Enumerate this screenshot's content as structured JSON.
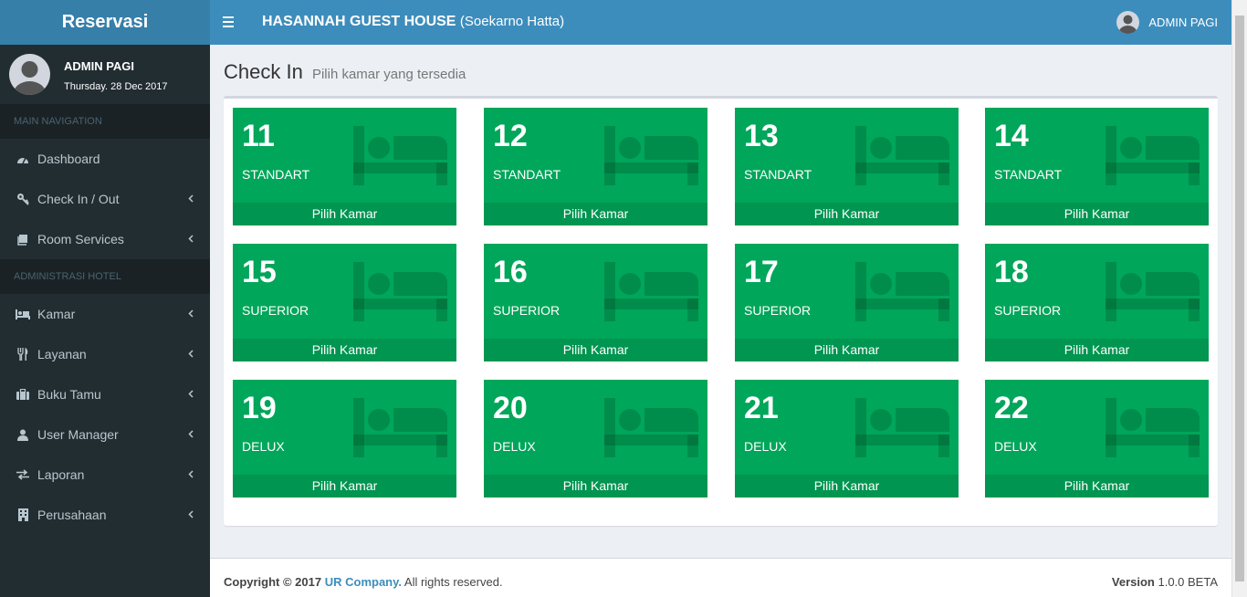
{
  "header": {
    "logo": "Reservasi",
    "brand_name": "HASANNAH GUEST HOUSE",
    "brand_sub": "(Soekarno Hatta)",
    "user": "ADMIN PAGI"
  },
  "sidebar": {
    "user_name": "ADMIN PAGI",
    "user_date": "Thursday. 28 Dec 2017",
    "main_nav_label": "MAIN NAVIGATION",
    "admin_label": "ADMINISTRASI HOTEL",
    "items": [
      {
        "label": "Dashboard",
        "icon": "dashboard-icon",
        "chevron": false
      },
      {
        "label": "Check In / Out",
        "icon": "key-icon",
        "chevron": true
      },
      {
        "label": "Room Services",
        "icon": "book-icon",
        "chevron": true
      },
      {
        "label": "Kamar",
        "icon": "bed-icon",
        "chevron": true
      },
      {
        "label": "Layanan",
        "icon": "cutlery-icon",
        "chevron": true
      },
      {
        "label": "Buku Tamu",
        "icon": "suitcase-icon",
        "chevron": true
      },
      {
        "label": "User Manager",
        "icon": "user-icon",
        "chevron": true
      },
      {
        "label": "Laporan",
        "icon": "exchange-icon",
        "chevron": true
      },
      {
        "label": "Perusahaan",
        "icon": "building-icon",
        "chevron": true
      }
    ]
  },
  "page": {
    "title": "Check In",
    "subtitle": "Pilih kamar yang tersedia"
  },
  "rooms": [
    {
      "number": "11",
      "type": "STANDART",
      "action": "Pilih Kamar"
    },
    {
      "number": "12",
      "type": "STANDART",
      "action": "Pilih Kamar"
    },
    {
      "number": "13",
      "type": "STANDART",
      "action": "Pilih Kamar"
    },
    {
      "number": "14",
      "type": "STANDART",
      "action": "Pilih Kamar"
    },
    {
      "number": "15",
      "type": "SUPERIOR",
      "action": "Pilih Kamar"
    },
    {
      "number": "16",
      "type": "SUPERIOR",
      "action": "Pilih Kamar"
    },
    {
      "number": "17",
      "type": "SUPERIOR",
      "action": "Pilih Kamar"
    },
    {
      "number": "18",
      "type": "SUPERIOR",
      "action": "Pilih Kamar"
    },
    {
      "number": "19",
      "type": "DELUX",
      "action": "Pilih Kamar"
    },
    {
      "number": "20",
      "type": "DELUX",
      "action": "Pilih Kamar"
    },
    {
      "number": "21",
      "type": "DELUX",
      "action": "Pilih Kamar"
    },
    {
      "number": "22",
      "type": "DELUX",
      "action": "Pilih Kamar"
    }
  ],
  "footer": {
    "copyright": "Copyright © 2017",
    "company": "UR Company.",
    "rights": "All rights reserved.",
    "version_label": "Version",
    "version_value": "1.0.0 BETA"
  },
  "colors": {
    "room_tile": "#00a65a",
    "navbar": "#3c8dbc",
    "logo_bar": "#367fa9",
    "sidebar": "#222d32"
  }
}
